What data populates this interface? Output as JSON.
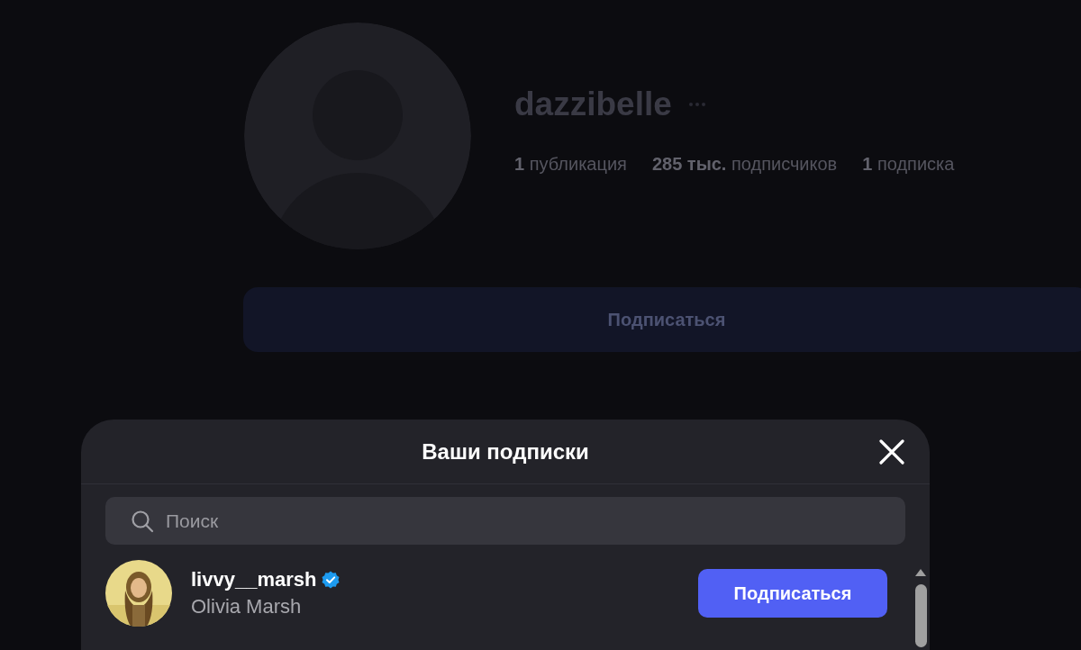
{
  "profile": {
    "username": "dazzibelle",
    "stats": [
      "**1** публикация",
      "**285 тыс.** подписчиков",
      "**1** подписка"
    ],
    "follow_button": "Подписаться"
  },
  "modal": {
    "title": "Ваши подписки",
    "search": {
      "placeholder": "Поиск"
    },
    "users": [
      {
        "username": "livvy__marsh",
        "verified": true,
        "full_name": "Olivia Marsh",
        "button": "Подписаться"
      }
    ]
  }
}
